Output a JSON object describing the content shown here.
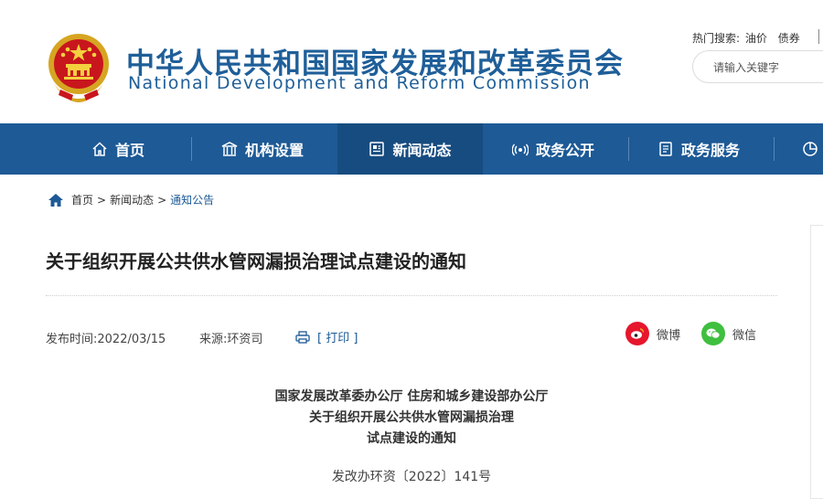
{
  "header": {
    "org_name_cn": "中华人民共和国国家发展和改革委员会",
    "org_name_en": "National Development and Reform Commission",
    "hot_search_label": "热门搜索:",
    "hot_search_terms": [
      "油价",
      "债券"
    ],
    "search_placeholder": "请输入关键字"
  },
  "nav": {
    "items": [
      {
        "label": "首页",
        "icon": "home-icon"
      },
      {
        "label": "机构设置",
        "icon": "building-icon"
      },
      {
        "label": "新闻动态",
        "icon": "news-icon",
        "active": true
      },
      {
        "label": "政务公开",
        "icon": "broadcast-icon"
      },
      {
        "label": "政务服务",
        "icon": "document-icon"
      },
      {
        "label": "",
        "icon": "pie-chart-icon"
      }
    ]
  },
  "breadcrumb": {
    "items": [
      "首页",
      "新闻动态",
      "通知公告"
    ],
    "separator": ">"
  },
  "article": {
    "title": "关于组织开展公共供水管网漏损治理试点建设的通知",
    "publish_time": "发布时间:2022/03/15",
    "source": "来源:环资司",
    "print_label": "[ 打印 ]",
    "share": [
      {
        "label": "微博",
        "icon": "weibo-icon",
        "color": "#e6162d"
      },
      {
        "label": "微信",
        "icon": "wechat-icon",
        "color": "#3fbf3f"
      }
    ],
    "doc_header_lines": [
      "国家发展改革委办公厅  住房和城乡建设部办公厅",
      "关于组织开展公共供水管网漏损治理",
      "试点建设的通知"
    ],
    "doc_number": "发改办环资〔2022〕141号"
  },
  "colors": {
    "brand_blue": "#1d5a96",
    "nav_active": "#174c80"
  }
}
